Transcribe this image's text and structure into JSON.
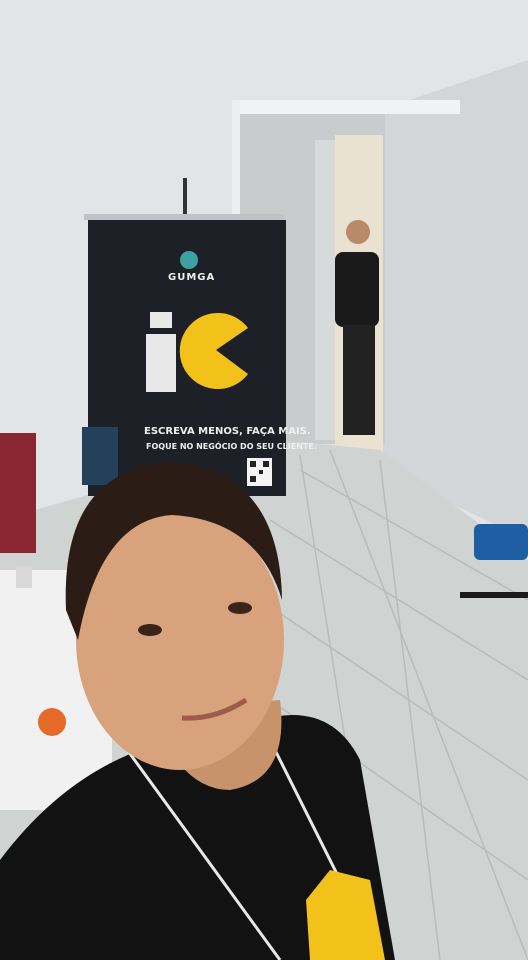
{
  "banner": {
    "brand": "GUMGA",
    "logo_glyph": "i",
    "mascot": "pacman-icon",
    "tagline_1": "ESCREVA MENOS, FAÇA MAIS.",
    "tagline_2": "FOQUE NO   NEGÓCIO DO SEU CLIENTE.",
    "qr": "qr-code-icon"
  },
  "colors": {
    "wall": "#e4e6e8",
    "banner": "#1d2027",
    "pacman": "#f2c21a",
    "shirt": "#121212"
  }
}
